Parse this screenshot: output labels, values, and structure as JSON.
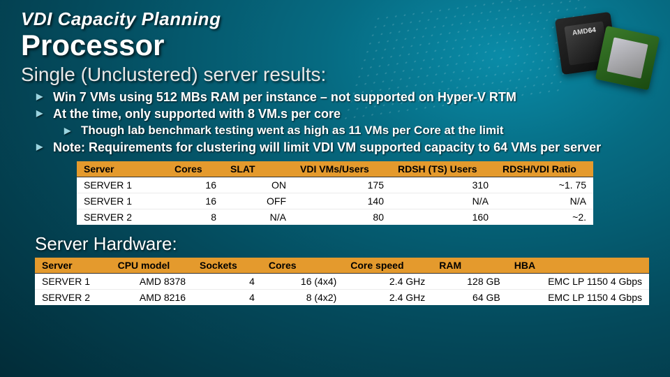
{
  "header": {
    "kicker": "VDI Capacity Planning",
    "title": "Processor",
    "subtitle": "Single (Unclustered) server results:"
  },
  "bullets": {
    "b1": "Win 7 VMs using 512 MBs RAM per instance – not supported on Hyper-V RTM",
    "b2": "At the time, only supported with 8 VM.s per core",
    "b2a": "Though lab benchmark testing went as high as 11 VMs per Core at the limit",
    "b3": "Note: Requirements for clustering will limit VDI VM supported capacity to 64 VMs per server"
  },
  "results_table": {
    "headers": [
      "Server",
      "Cores",
      "SLAT",
      "VDI VMs/Users",
      "RDSH (TS) Users",
      "RDSH/VDI Ratio"
    ],
    "rows": [
      [
        "SERVER 1",
        "16",
        "ON",
        "175",
        "310",
        "~1. 75"
      ],
      [
        "SERVER 1",
        "16",
        "OFF",
        "140",
        "N/A",
        "N/A"
      ],
      [
        "SERVER 2",
        "8",
        "N/A",
        "80",
        "160",
        "~2."
      ]
    ]
  },
  "hardware_title": "Server Hardware:",
  "hardware_table": {
    "headers": [
      "Server",
      "CPU model",
      "Sockets",
      "Cores",
      "Core speed",
      "RAM",
      "HBA"
    ],
    "rows": [
      [
        "SERVER 1",
        "AMD 8378",
        "4",
        "16 (4x4)",
        "2.4 GHz",
        "128 GB",
        "EMC LP 1150 4 Gbps"
      ],
      [
        "SERVER 2",
        "AMD 8216",
        "4",
        "8 (4x2)",
        "2.4 GHz",
        "64 GB",
        "EMC LP 1150 4 Gbps"
      ]
    ]
  }
}
